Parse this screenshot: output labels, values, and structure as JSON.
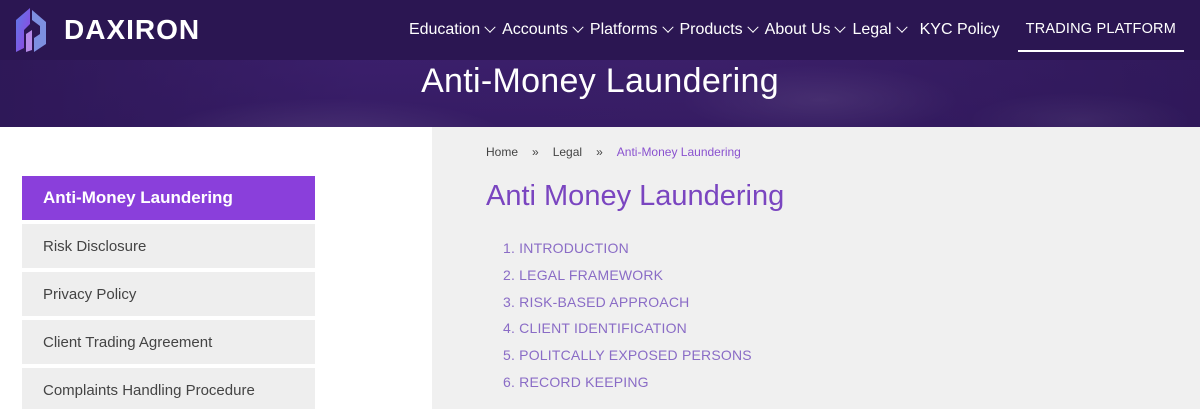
{
  "brand": {
    "name": "DAXIRON"
  },
  "nav": {
    "items": [
      {
        "label": "Education",
        "dropdown": true
      },
      {
        "label": "Accounts",
        "dropdown": true
      },
      {
        "label": "Platforms",
        "dropdown": true
      },
      {
        "label": "Products",
        "dropdown": true
      },
      {
        "label": "About Us",
        "dropdown": true
      },
      {
        "label": "Legal",
        "dropdown": true
      }
    ],
    "kyc": "KYC Policy",
    "trading_platform": "TRADING PLATFORM"
  },
  "hero": {
    "title": "Anti-Money Laundering"
  },
  "sidebar": {
    "items": [
      {
        "label": "Anti-Money Laundering",
        "active": true
      },
      {
        "label": "Risk Disclosure"
      },
      {
        "label": "Privacy Policy"
      },
      {
        "label": "Client Trading Agreement"
      },
      {
        "label": "Complaints Handling Procedure"
      }
    ]
  },
  "breadcrumb": {
    "home": "Home",
    "sep": "»",
    "legal": "Legal",
    "current": "Anti-Money Laundering"
  },
  "content": {
    "title": "Anti Money Laundering",
    "toc": [
      "1. INTRODUCTION",
      "2. LEGAL FRAMEWORK",
      "3. RISK-BASED APPROACH",
      "4. CLIENT IDENTIFICATION",
      "5. POLITCALLY EXPOSED PERSONS",
      "6. RECORD KEEPING"
    ]
  },
  "colors": {
    "accent": "#8a3fdb",
    "header_bg": "#2b1652",
    "title_purple": "#7a45c0",
    "toc_purple": "#8a6cc6"
  },
  "icons": {
    "logo": "daxiron-logo-icon",
    "dropdown": "chevron-down-icon"
  }
}
